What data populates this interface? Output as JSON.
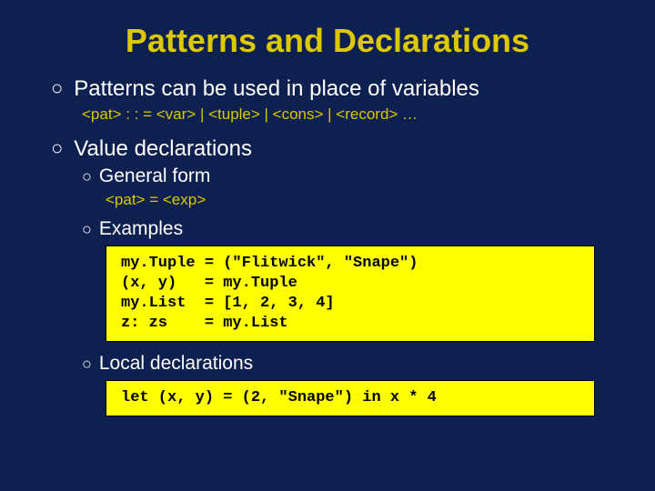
{
  "slide": {
    "title": "Patterns and Declarations",
    "bullet1": {
      "text": "Patterns can be used in place of variables",
      "grammar": "<pat> : : = <var> | <tuple> | <cons> | <record> …"
    },
    "bullet2": {
      "text": "Value declarations",
      "sub1": {
        "label": "General form",
        "grammar": "<pat> = <exp>"
      },
      "sub2": {
        "label": "Examples",
        "code": "my.Tuple = (\"Flitwick\", \"Snape\")\n(x, y)   = my.Tuple\nmy.List  = [1, 2, 3, 4]\nz: zs    = my.List"
      },
      "sub3": {
        "label": "Local declarations",
        "code": "let (x, y) = (2, \"Snape\") in x * 4"
      }
    }
  },
  "markers": {
    "circle": "○"
  }
}
